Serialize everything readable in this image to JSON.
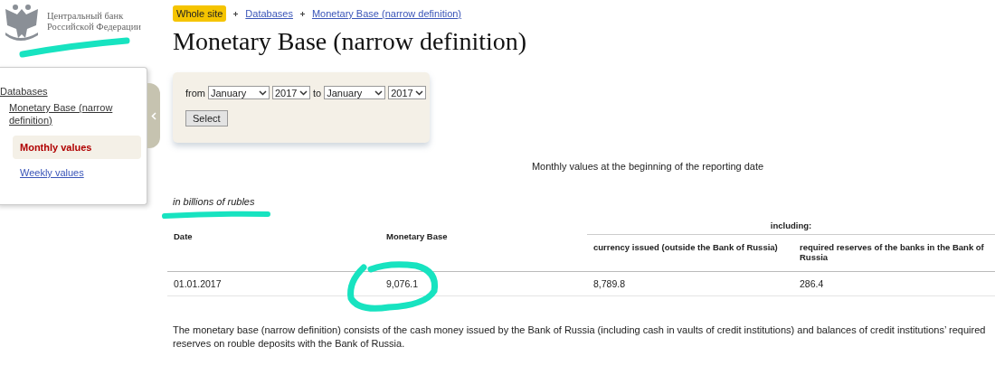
{
  "logo": {
    "lines": [
      "Центральный банк",
      "Российской Федерации"
    ]
  },
  "breadcrumbs": [
    {
      "label": "Whole site",
      "kind": "badge"
    },
    {
      "label": "Databases",
      "kind": "link"
    },
    {
      "label": "Monetary Base (narrow definition)",
      "kind": "link"
    }
  ],
  "title": "Monetary Base (narrow definition)",
  "sidebar": {
    "items": [
      {
        "label": "Databases",
        "children": [
          {
            "label": "Monetary Base (narrow definition)",
            "children": [
              {
                "label": "Monthly values",
                "selected": true
              },
              {
                "label": "Weekly values",
                "selected": false
              }
            ]
          }
        ]
      }
    ]
  },
  "filter": {
    "from_label": "from",
    "from_month": "January",
    "from_year": "2017",
    "to_label": "to",
    "to_month": "January",
    "to_year": "2017",
    "button": "Select"
  },
  "caption": "Monthly values at the beginning of the reporting date",
  "units": "in billions of rubles",
  "table": {
    "group_header": "including:",
    "columns": [
      "Date",
      "Monetary Base",
      "currency issued (outside the Bank of Russia)",
      "required reserves of the banks in the Bank of Russia"
    ],
    "rows": [
      [
        "01.01.2017",
        "9,076.1",
        "8,789.8",
        "286.4"
      ]
    ]
  },
  "note": "The monetary base (narrow definition) consists of the cash money issued by the Bank of Russia (including cash in vaults of credit institutions) and balances of credit institutions’ required reserves on rouble deposits with the Bank of Russia."
}
